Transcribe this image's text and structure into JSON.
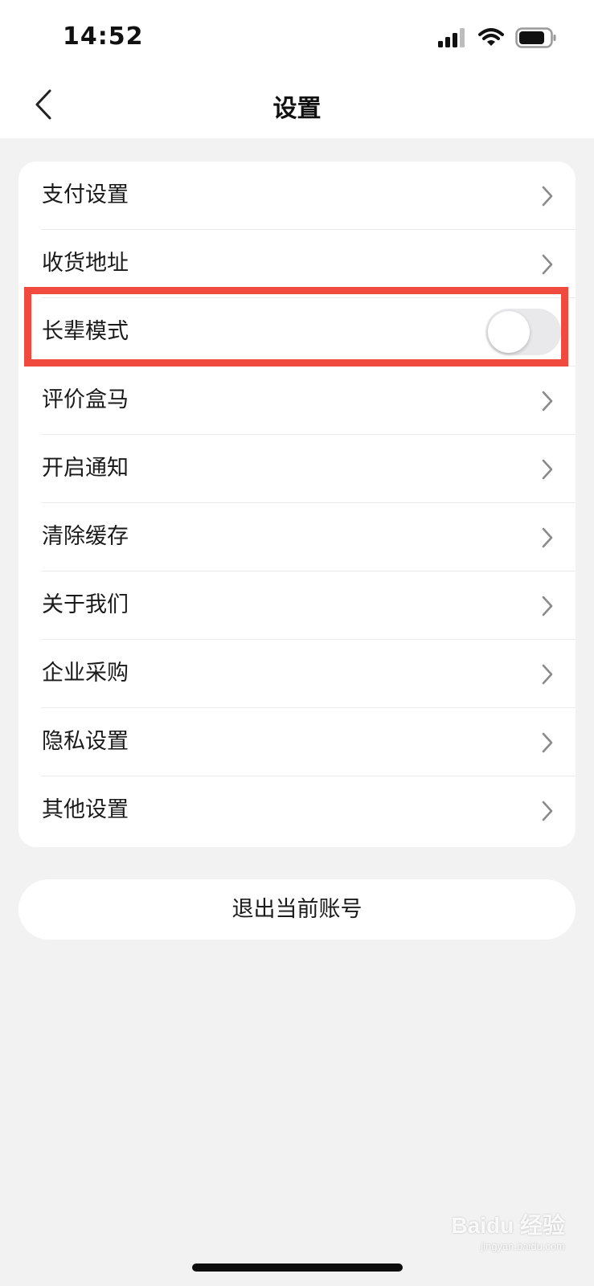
{
  "status_bar": {
    "time": "14:52",
    "icons": [
      "signal-icon",
      "wifi-icon",
      "battery-icon"
    ]
  },
  "header": {
    "title": "设置",
    "back_icon": "chevron-left-icon"
  },
  "settings": {
    "items": [
      {
        "label": "支付设置",
        "control": "chevron"
      },
      {
        "label": "收货地址",
        "control": "chevron"
      },
      {
        "label": "长辈模式",
        "control": "toggle",
        "enabled": false
      },
      {
        "label": "评价盒马",
        "control": "chevron"
      },
      {
        "label": "开启通知",
        "control": "chevron"
      },
      {
        "label": "清除缓存",
        "control": "chevron"
      },
      {
        "label": "关于我们",
        "control": "chevron"
      },
      {
        "label": "企业采购",
        "control": "chevron"
      },
      {
        "label": "隐私设置",
        "control": "chevron"
      },
      {
        "label": "其他设置",
        "control": "chevron"
      }
    ]
  },
  "logout_label": "退出当前账号",
  "watermark": {
    "main": "Baidu 经验",
    "sub": "jingyan.baidu.com"
  },
  "colors": {
    "highlight": "#f04a3e",
    "background": "#f2f2f2",
    "card": "#ffffff",
    "toggle_off": "#e9e9eb"
  }
}
